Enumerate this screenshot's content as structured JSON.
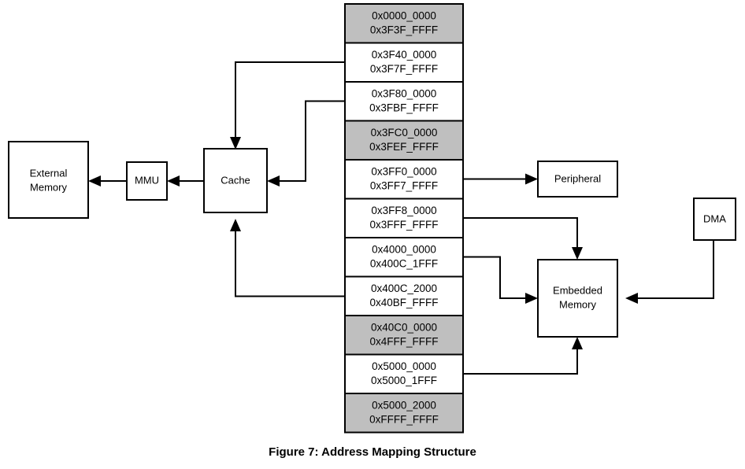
{
  "figure": {
    "caption": "Figure 7: Address Mapping Structure",
    "colors": {
      "shaded_row": "#bfbfbf",
      "plain_row": "#ffffff",
      "stroke": "#000000",
      "background": "#ffffff"
    }
  },
  "blocks": {
    "external_memory": {
      "label_line1": "External",
      "label_line2": "Memory"
    },
    "mmu": {
      "label": "MMU"
    },
    "cache": {
      "label": "Cache"
    },
    "peripheral": {
      "label": "Peripheral"
    },
    "embedded_memory": {
      "label_line1": "Embedded",
      "label_line2": "Memory"
    },
    "dma": {
      "label": "DMA"
    }
  },
  "address_map": {
    "rows": [
      {
        "index": 0,
        "start": "0x0000_0000",
        "end": "0x3F3F_FFFF",
        "shaded": true,
        "target": ""
      },
      {
        "index": 1,
        "start": "0x3F40_0000",
        "end": "0x3F7F_FFFF",
        "shaded": false,
        "target": "Cache"
      },
      {
        "index": 2,
        "start": "0x3F80_0000",
        "end": "0x3FBF_FFFF",
        "shaded": false,
        "target": "Cache"
      },
      {
        "index": 3,
        "start": "0x3FC0_0000",
        "end": "0x3FEF_FFFF",
        "shaded": true,
        "target": ""
      },
      {
        "index": 4,
        "start": "0x3FF0_0000",
        "end": "0x3FF7_FFFF",
        "shaded": false,
        "target": "Peripheral"
      },
      {
        "index": 5,
        "start": "0x3FF8_0000",
        "end": "0x3FFF_FFFF",
        "shaded": false,
        "target": "Embedded Memory"
      },
      {
        "index": 6,
        "start": "0x4000_0000",
        "end": "0x400C_1FFF",
        "shaded": false,
        "target": "Embedded Memory"
      },
      {
        "index": 7,
        "start": "0x400C_2000",
        "end": "0x40BF_FFFF",
        "shaded": false,
        "target": "Cache"
      },
      {
        "index": 8,
        "start": "0x40C0_0000",
        "end": "0x4FFF_FFFF",
        "shaded": true,
        "target": ""
      },
      {
        "index": 9,
        "start": "0x5000_0000",
        "end": "0x5000_1FFF",
        "shaded": false,
        "target": "Embedded Memory"
      },
      {
        "index": 10,
        "start": "0x5000_2000",
        "end": "0xFFFF_FFFF",
        "shaded": true,
        "target": ""
      }
    ]
  },
  "connections": [
    {
      "id": "cache-to-mmu",
      "from": "Cache",
      "to": "MMU"
    },
    {
      "id": "mmu-to-external-memory",
      "from": "MMU",
      "to": "External Memory"
    },
    {
      "id": "row1-to-cache-top",
      "from": "0x3F40_0000",
      "to": "Cache"
    },
    {
      "id": "row2-to-cache-right",
      "from": "0x3F80_0000",
      "to": "Cache"
    },
    {
      "id": "row7-to-cache-bottom",
      "from": "0x400C_2000",
      "to": "Cache"
    },
    {
      "id": "row4-to-peripheral",
      "from": "0x3FF0_0000",
      "to": "Peripheral"
    },
    {
      "id": "row5-to-embedded-top",
      "from": "0x3FF8_0000",
      "to": "Embedded Memory"
    },
    {
      "id": "row6-to-embedded-left",
      "from": "0x4000_0000",
      "to": "Embedded Memory"
    },
    {
      "id": "row9-to-embedded-bottom",
      "from": "0x5000_0000",
      "to": "Embedded Memory"
    },
    {
      "id": "dma-to-embedded-right",
      "from": "DMA",
      "to": "Embedded Memory"
    }
  ]
}
